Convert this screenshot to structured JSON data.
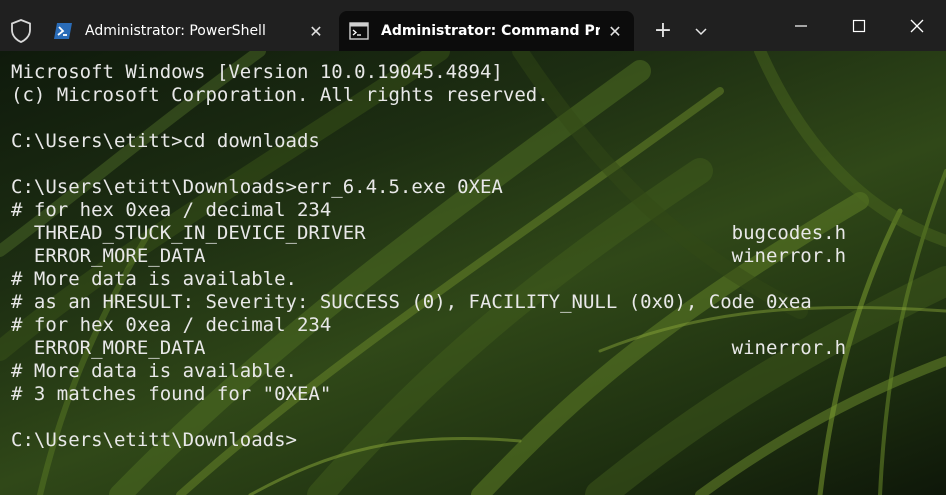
{
  "window": {
    "tabs": [
      {
        "label": "Administrator: PowerShell",
        "close_glyph": "✕",
        "icon": "powershell-icon",
        "active": false
      },
      {
        "label": "Administrator: Command Prompt",
        "close_glyph": "✕",
        "icon": "cmd-icon",
        "active": true
      }
    ],
    "new_tab_glyph": "+",
    "colors": {
      "titlebar": "#202020",
      "active_tab": "#0c0c0c",
      "text": "#e8e8e8"
    }
  },
  "terminal": {
    "lines": [
      "Microsoft Windows [Version 10.0.19045.4894]",
      "(c) Microsoft Corporation. All rights reserved.",
      "",
      "C:\\Users\\etitt>cd downloads",
      "",
      "C:\\Users\\etitt\\Downloads>err_6.4.5.exe 0XEA",
      "# for hex 0xea / decimal 234",
      "  THREAD_STUCK_IN_DEVICE_DRIVER                                bugcodes.h",
      "  ERROR_MORE_DATA                                              winerror.h",
      "# More data is available.",
      "# as an HRESULT: Severity: SUCCESS (0), FACILITY_NULL (0x0), Code 0xea",
      "# for hex 0xea / decimal 234",
      "  ERROR_MORE_DATA                                              winerror.h",
      "# More data is available.",
      "# 3 matches found for \"0XEA\"",
      "",
      "C:\\Users\\etitt\\Downloads>"
    ]
  }
}
